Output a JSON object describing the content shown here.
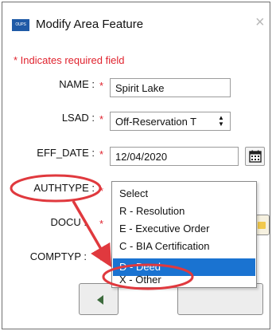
{
  "window": {
    "title": "Modify Area Feature",
    "app_logo_text": "OUPS",
    "close_glyph": "×"
  },
  "form": {
    "required_note": "* Indicates required field",
    "required_marker": "*",
    "name": {
      "label": "NAME :",
      "value": "Spirit Lake"
    },
    "lsad": {
      "label": "LSAD :",
      "value": "Off-Reservation T"
    },
    "eff_date": {
      "label": "EFF_DATE :",
      "value": "12/04/2020",
      "button_icon": "calendar-icon"
    },
    "authtype": {
      "label": "AUTHTYPE :"
    },
    "docu": {
      "label": "DOCU :"
    },
    "comptyp": {
      "label": "COMPTYP :"
    }
  },
  "authtype_dropdown": {
    "options": [
      "Select",
      "R - Resolution",
      "E - Executive Order",
      "C - BIA Certification",
      "D - Deed",
      "X - Other"
    ],
    "selected_index": 4,
    "selected_color": "#1a73d1"
  },
  "annotation": {
    "color": "#e0393e",
    "highlights": [
      "AUTHTYPE :",
      "D - Deed"
    ]
  }
}
